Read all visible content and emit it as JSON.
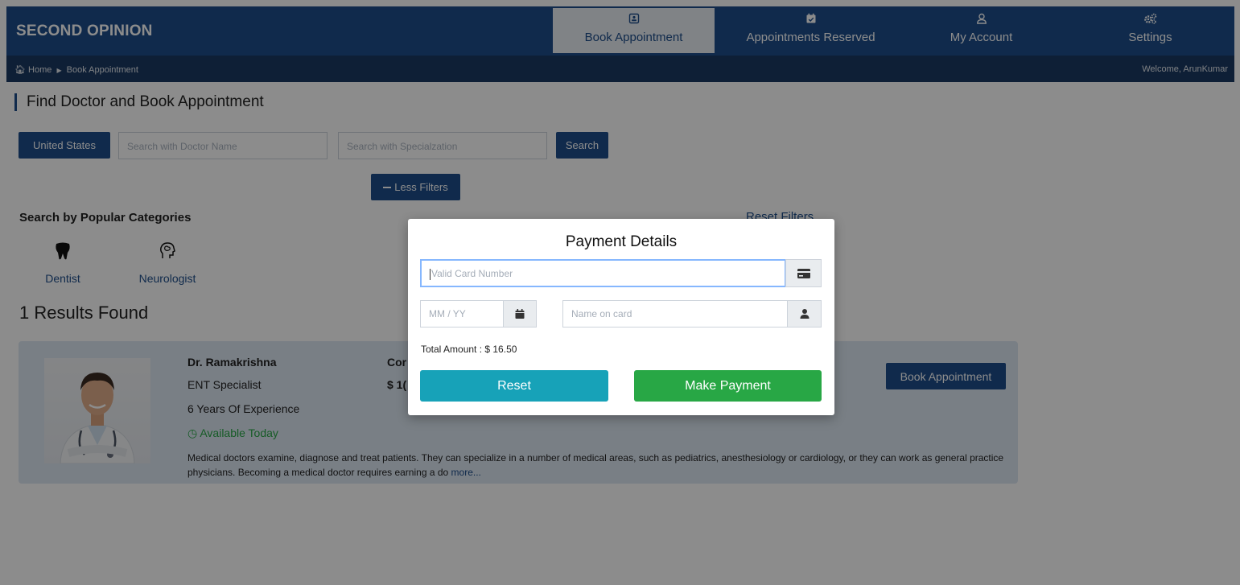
{
  "app": {
    "brand": "SECOND OPINION"
  },
  "nav": {
    "items": [
      {
        "label": "Book Appointment",
        "icon": "contact-card-icon",
        "active": true
      },
      {
        "label": "Appointments Reserved",
        "icon": "calendar-check-icon",
        "active": false
      },
      {
        "label": "My Account",
        "icon": "user-icon",
        "active": false
      },
      {
        "label": "Settings",
        "icon": "cogs-icon",
        "active": false
      }
    ]
  },
  "breadcrumb": {
    "home": "Home",
    "current": "Book Appointment",
    "welcome": "Welcome, ArunKumar"
  },
  "page": {
    "title": "Find Doctor and Book Appointment",
    "country_button": "United States",
    "doctor_search_placeholder": "Search with Doctor Name",
    "specialization_search_placeholder": "Search with Specialzation",
    "search_button": "Search",
    "less_filters_button": "Less Filters",
    "popular_categories_heading": "Search by Popular Categories",
    "reset_filters": "Reset Filters",
    "categories": [
      {
        "label": "Dentist",
        "icon": "tooth-icon"
      },
      {
        "label": "Neurologist",
        "icon": "brain-head-icon"
      }
    ],
    "results_count": "1 Results Found"
  },
  "doctor": {
    "name": "Dr. Ramakrishna",
    "specialty": "ENT Specialist",
    "experience": "6 Years Of Experience",
    "availability": "Available Today",
    "consultation_label": "Cor",
    "consultation_fee": "$ 1(",
    "description": "Medical doctors examine, diagnose and treat patients. They can specialize in a number of medical areas, such as pediatrics, anesthesiology or cardiology, or they can work as general practice physicians. Becoming a medical doctor requires earning a do",
    "more_link": "more...",
    "book_button": "Book Appointment"
  },
  "modal": {
    "title": "Payment Details",
    "card_number_placeholder": "Valid Card Number",
    "expiry_placeholder": "MM / YY",
    "name_placeholder": "Name on card",
    "total_amount": "Total Amount : $ 16.50",
    "reset_button": "Reset",
    "pay_button": "Make Payment"
  },
  "colors": {
    "primary": "#1e4e8a",
    "breadcrumb_bar": "#1a3a63",
    "success": "#28a745",
    "info": "#17a2b8",
    "overlay": "rgba(0,0,0,0.45)"
  }
}
